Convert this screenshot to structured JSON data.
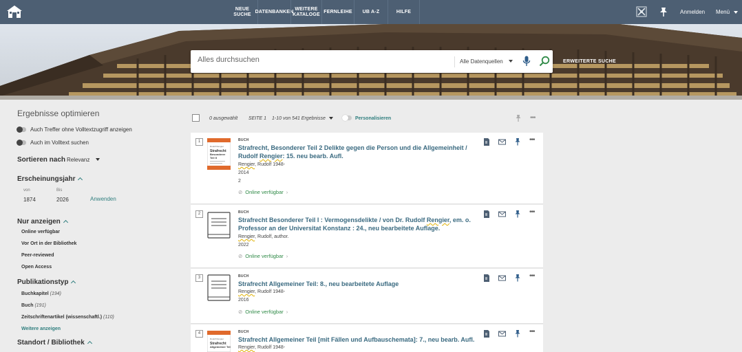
{
  "nav": {
    "items": [
      {
        "label": "NEUE SUCHE"
      },
      {
        "label": "DATENBANKEN"
      },
      {
        "label": "WEITERE KATALOGE"
      },
      {
        "label": "FERNLEIHE"
      },
      {
        "label": "UB A-Z"
      },
      {
        "label": "HILFE"
      }
    ],
    "login": "Anmelden",
    "menu": "Menü"
  },
  "search": {
    "placeholder": "Alles durchsuchen",
    "scope": "Alle Datenquellen",
    "advanced": "ERWEITERTE SUCHE"
  },
  "sidebar": {
    "title": "Ergebnisse optimieren",
    "toggle1": "Auch Treffer ohne Volltextzugriff anzeigen",
    "toggle2": "Auch im Volltext suchen",
    "sort_label": "Sortieren nach",
    "sort_value": "Relevanz",
    "year_head": "Erscheinungsjahr",
    "from_label": "von",
    "to_label": "Bis",
    "from_value": "1874",
    "to_value": "2026",
    "apply": "Anwenden",
    "show_head": "Nur anzeigen",
    "show_items": [
      "Online verfügbar",
      "Vor Ort in der Bibliothek",
      "Peer-reviewed",
      "Open Access"
    ],
    "type_head": "Publikationstyp",
    "type_items": [
      {
        "label": "Buchkapitel",
        "count": "(194)"
      },
      {
        "label": "Buch",
        "count": "(191)"
      },
      {
        "label": "Zeitschriftenartikel (wissenschaftl.)",
        "count": "(110)"
      }
    ],
    "more": "Weitere anzeigen",
    "location_head": "Standort / Bibliothek"
  },
  "results_header": {
    "selected": "0 ausgewählt",
    "page": "SEITE 1",
    "count": "1-10 von 541 Ergebnisse",
    "personalize": "Personalisieren"
  },
  "results": [
    {
      "num": "1",
      "type": "BUCH",
      "title_a": "Strafrecht, Besonderer Teil 2 Delikte gegen die Person und die Allgemeinheit / Rudolf ",
      "title_b": "Rengier",
      "title_c": ": 15. neu bearb. Aufl.",
      "author_a": "Rengier",
      "author_b": ", Rudolf 1948-",
      "year": "2014",
      "extra": "2",
      "avail": "Online verfügbar"
    },
    {
      "num": "2",
      "type": "BUCH",
      "title_a": "Strafrecht Besonderer Teil I : Vermogensdelikte / von Dr. Rudolf ",
      "title_b": "Rengier",
      "title_c": ", em. o. Professor an der Universitat Konstanz : 24., neu bearbeitete Auflage.",
      "author_a": "Rengier",
      "author_b": ", Rudolf, author.",
      "year": "2022",
      "avail": "Online verfügbar"
    },
    {
      "num": "3",
      "type": "BUCH",
      "title": "Strafrecht Allgemeiner Teil: 8., neu bearbeitete Auflage",
      "author_a": "Rengier",
      "author_b": ", Rudolf 1948-",
      "year": "2016",
      "avail": "Online verfügbar"
    },
    {
      "num": "4",
      "type": "BUCH",
      "title": "Strafrecht Allgemeiner Teil [mit Fällen und Aufbauschemata]: 7., neu bearb. Aufl.",
      "author_a": "Rengier",
      "author_b": ", Rudolf 1948-"
    }
  ],
  "cover_art": {
    "book1_title": "Strafrecht Besonderer Teil II",
    "book4_title": "Strafrecht Allgemeiner Teil"
  },
  "colors": {
    "topbar": "#4d5f73",
    "accent": "#2f7e7e",
    "title": "#3a6a80",
    "available": "#2f8a47"
  }
}
